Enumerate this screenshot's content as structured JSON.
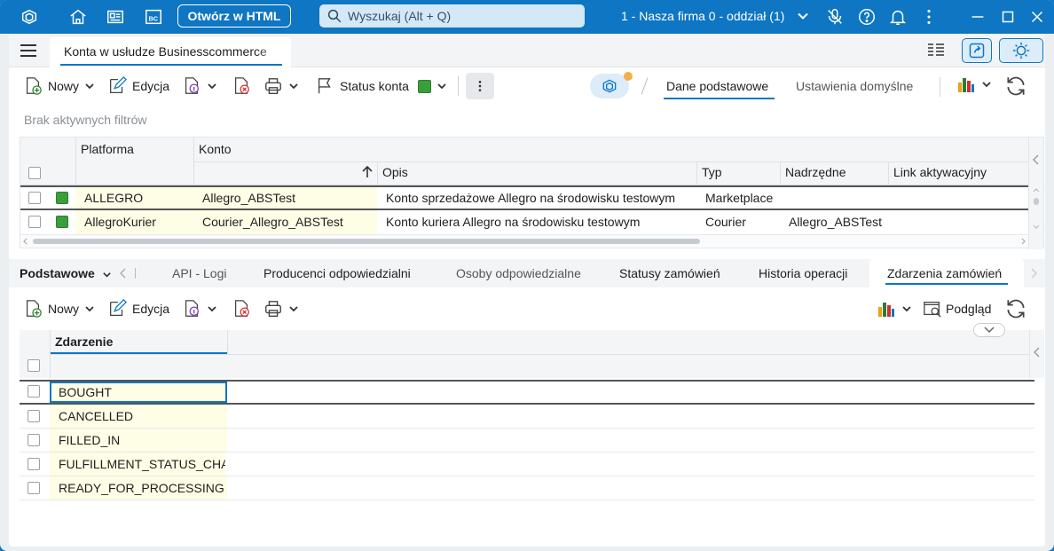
{
  "titlebar": {
    "open_html": "Otwórz w HTML",
    "search_placeholder": "Wyszukaj (Alt + Q)",
    "company": "1 - Nasza firma 0 - oddział (1)"
  },
  "document_tab": "Konta w usłudze Businesscommerce",
  "toolbar": {
    "new": "Nowy",
    "edit": "Edycja",
    "status": "Status konta",
    "view_tabs": [
      "Dane podstawowe",
      "Ustawienia domyślne"
    ],
    "status_color": "#3a9f3a"
  },
  "filters_text": "Brak aktywnych filtrów",
  "grid1": {
    "group_headers": [
      "Platforma",
      "Konto"
    ],
    "columns": [
      "Opis",
      "Typ",
      "Nadrzędne",
      "Link aktywacyjny"
    ],
    "rows": [
      {
        "platform": "ALLEGRO",
        "account": "Allegro_ABSTest",
        "desc": "Konto sprzedażowe Allegro na środowisku testowym",
        "type": "Marketplace",
        "parent": "",
        "link": ""
      },
      {
        "platform": "AllegroKurier",
        "account": "Courier_Allegro_ABSTest",
        "desc": "Konto kuriera Allegro na środowisku testowym",
        "type": "Courier",
        "parent": "Allegro_ABSTest",
        "link": ""
      }
    ]
  },
  "lower_tabs": {
    "group": "Podstawowe",
    "items": [
      "API - Logi",
      "Producenci odpowiedzialni",
      "Osoby odpowiedzialne",
      "Statusy zamówień",
      "Historia operacji"
    ],
    "active": "Zdarzenia zamówień"
  },
  "toolbar2": {
    "new": "Nowy",
    "edit": "Edycja",
    "preview": "Podgląd"
  },
  "grid2": {
    "column": "Zdarzenie",
    "rows": [
      "BOUGHT",
      "CANCELLED",
      "FILLED_IN",
      "FULFILLMENT_STATUS_CHANGED",
      "READY_FOR_PROCESSING"
    ]
  }
}
